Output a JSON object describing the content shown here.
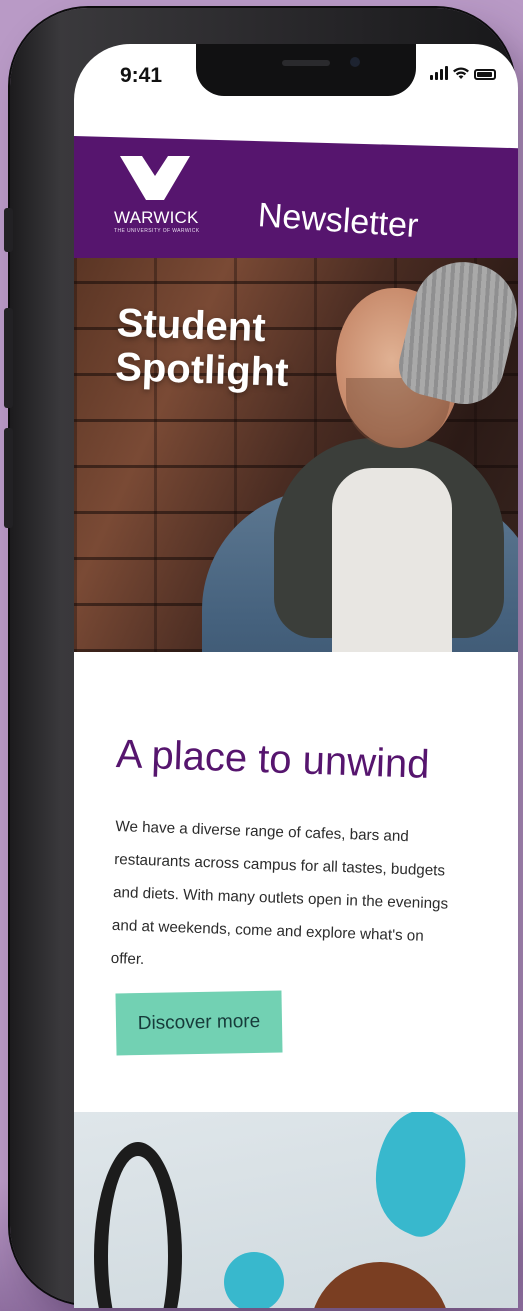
{
  "status_bar": {
    "time": "9:41",
    "icons": [
      "signal-icon",
      "wifi-icon",
      "battery-icon"
    ]
  },
  "header": {
    "logo_text": "WARWICK",
    "logo_subtext": "THE UNIVERSITY OF WARWICK",
    "title": "Newsletter"
  },
  "hero": {
    "title_line1": "Student",
    "title_line2": "Spotlight"
  },
  "article": {
    "headline": "A place to unwind",
    "body": "We have a diverse range of cafes, bars and restaurants across campus for all tastes, budgets and diets. With many outlets open in the evenings and at weekends, come and explore what's on offer.",
    "cta_label": "Discover more"
  },
  "colors": {
    "brand_purple": "#56156e",
    "cta_green": "#72d1b3",
    "background": "#b99ac6"
  }
}
